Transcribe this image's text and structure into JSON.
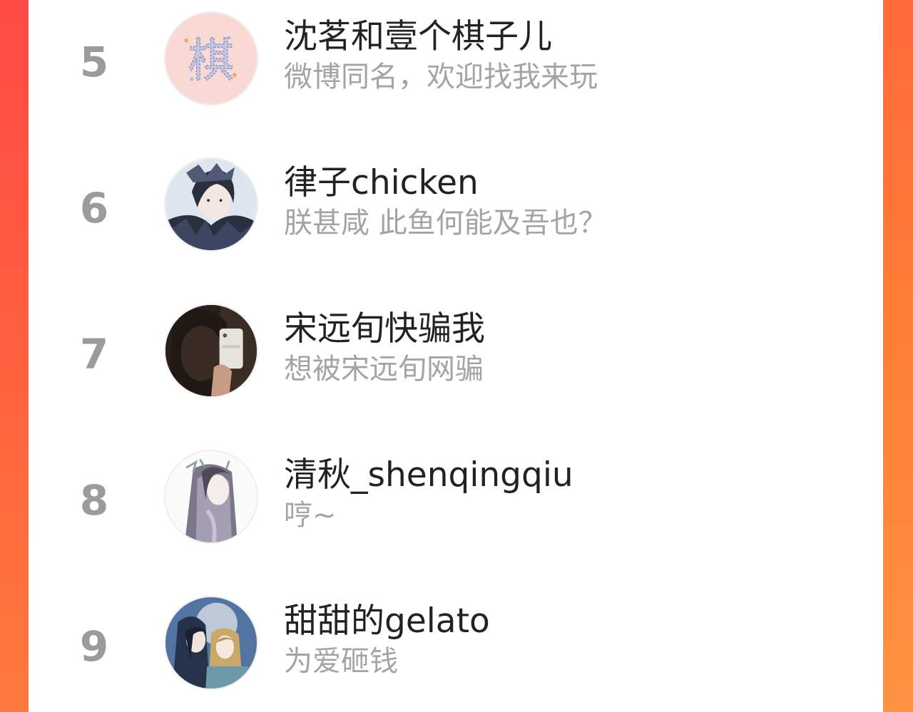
{
  "colors": {
    "background_gradient_start": "#ff4a45",
    "background_gradient_end": "#ff7a3c",
    "rank_color": "#9b9b9b",
    "name_color": "#222222",
    "desc_color": "#a4a4a4"
  },
  "leaderboard": {
    "items": [
      {
        "rank": "5",
        "name": "沈茗和壹个棋子儿",
        "desc": "微博同名，欢迎找我来玩",
        "avatar_icon": "qi-character-avatar",
        "avatar_text": "棋"
      },
      {
        "rank": "6",
        "name": "律子chicken",
        "desc": "朕甚咸 此鱼何能及吾也？",
        "avatar_icon": "anime-character-avatar"
      },
      {
        "rank": "7",
        "name": "宋远旬快骗我",
        "desc": "想被宋远旬网骗",
        "avatar_icon": "selfie-photo-avatar"
      },
      {
        "rank": "8",
        "name": "清秋_shenqingqiu",
        "desc": "哼~",
        "avatar_icon": "ink-painting-character-avatar"
      },
      {
        "rank": "9",
        "name": "甜甜的gelato",
        "desc": "为爱砸钱",
        "avatar_icon": "moonlight-couple-avatar"
      }
    ]
  }
}
